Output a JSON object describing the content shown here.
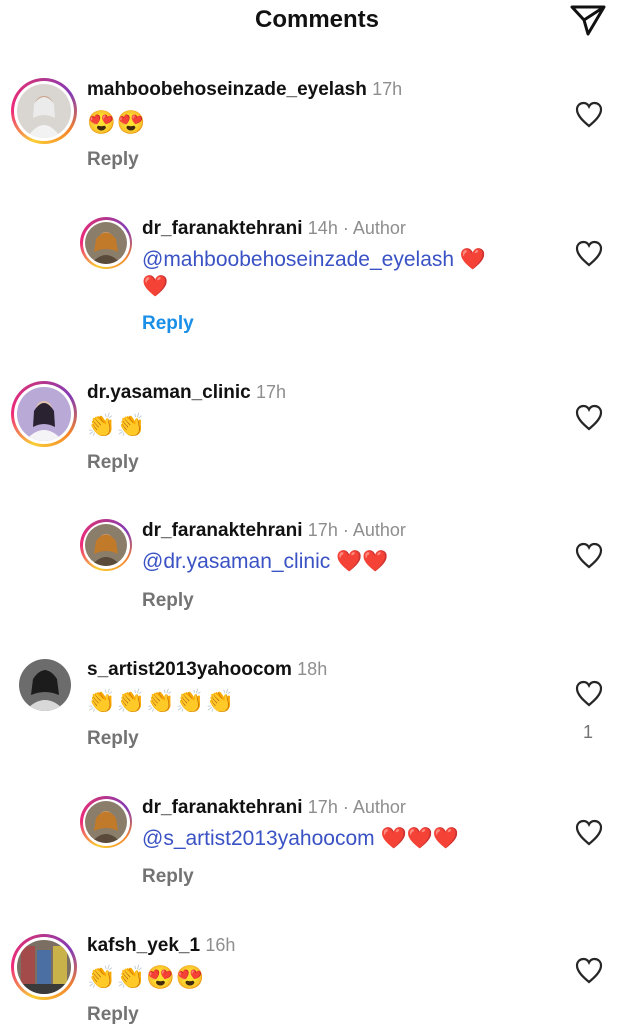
{
  "header": {
    "title": "Comments",
    "send_icon": "paper-plane-icon"
  },
  "comments": [
    {
      "username": "mahboobehoseinzade_eyelash",
      "time": "17h",
      "text": "😍😍",
      "reply": "Reply",
      "replies": [
        {
          "username": "dr_faranaktehrani",
          "meta": "14h · Author",
          "mention": "@mahboobehoseinzade_eyelash",
          "text_after": "❤️",
          "text_line2": "❤️",
          "reply": "Reply"
        }
      ]
    },
    {
      "username": "dr.yasaman_clinic",
      "time": "17h",
      "text": "👏👏",
      "reply": "Reply",
      "replies": [
        {
          "username": "dr_faranaktehrani",
          "meta": "17h · Author",
          "mention": "@dr.yasaman_clinic",
          "text_after": "❤️❤️",
          "reply": "Reply"
        }
      ]
    },
    {
      "username": "s_artist2013yahoocom",
      "time": "18h",
      "text": "👏👏👏👏👏",
      "reply": "Reply",
      "like_count": "1",
      "replies": [
        {
          "username": "dr_faranaktehrani",
          "meta": "17h · Author",
          "mention": "@s_artist2013yahoocom",
          "text_after": "❤️❤️❤️",
          "reply": "Reply"
        }
      ]
    },
    {
      "username": "kafsh_yek_1",
      "time": "16h",
      "text": "👏👏😍😍",
      "reply": "Reply"
    }
  ],
  "colors": {
    "mention": "#3a52c4",
    "reply_active": "#1a8fe8",
    "meta": "#8e8e8e"
  }
}
